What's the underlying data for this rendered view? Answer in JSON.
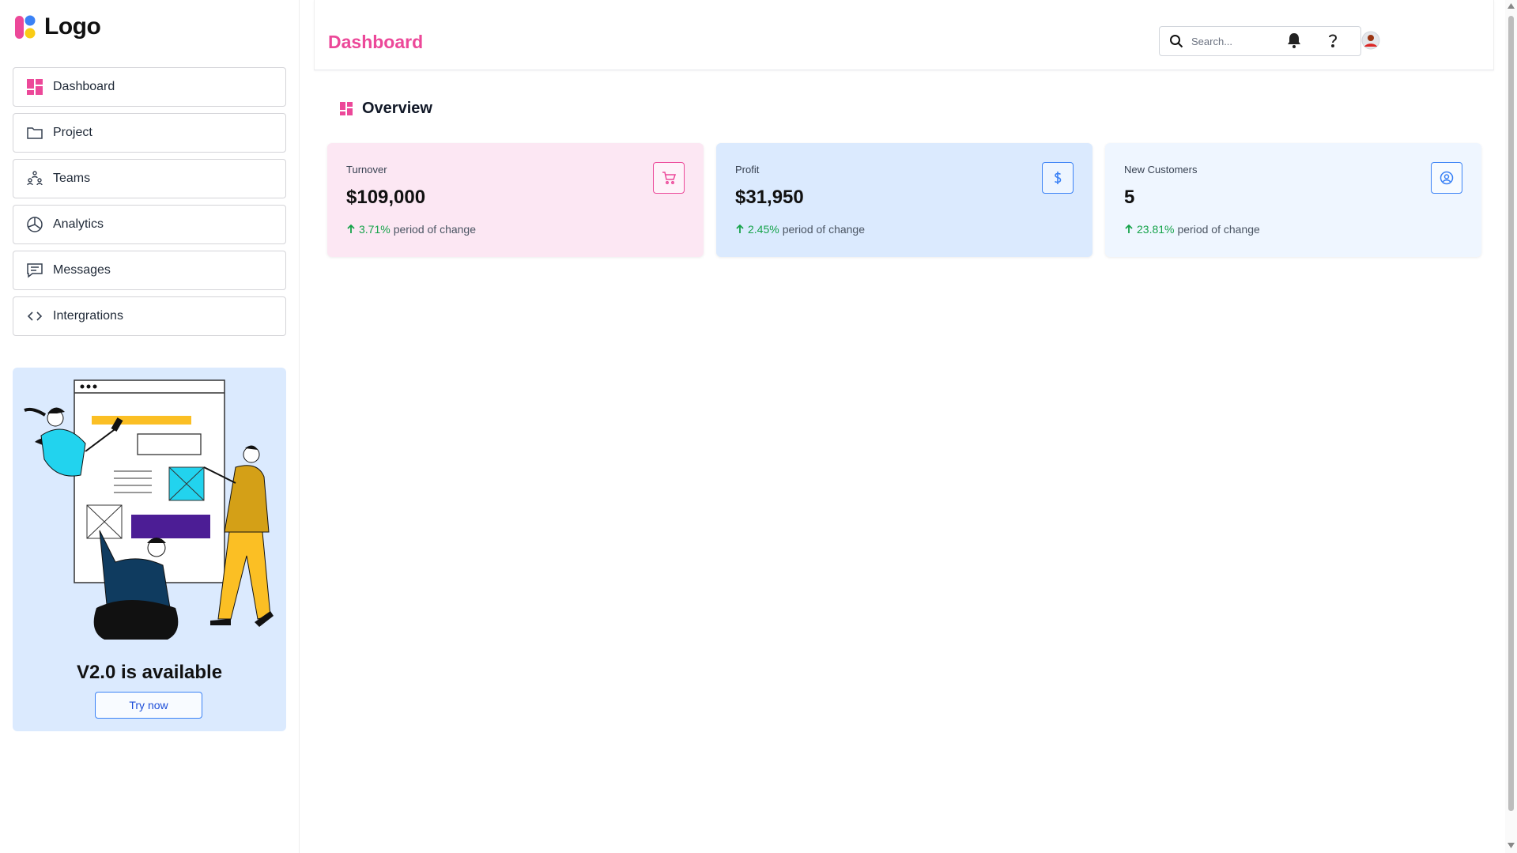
{
  "brand": {
    "logo_text": "Logo"
  },
  "nav": {
    "items": [
      {
        "label": "Dashboard",
        "icon": "dashboard-icon"
      },
      {
        "label": "Project",
        "icon": "folder-icon"
      },
      {
        "label": "Teams",
        "icon": "teams-icon"
      },
      {
        "label": "Analytics",
        "icon": "pie-chart-icon"
      },
      {
        "label": "Messages",
        "icon": "message-icon"
      },
      {
        "label": "Intergrations",
        "icon": "code-icon"
      }
    ]
  },
  "promo": {
    "title": "V2.0 is available",
    "button_label": "Try now"
  },
  "header": {
    "title": "Dashboard",
    "search_placeholder": "Search..."
  },
  "overview": {
    "title": "Overview",
    "cards": [
      {
        "label": "Turnover",
        "value": "$109,000",
        "change_pct": "3.71%",
        "change_text": "period of change",
        "icon": "cart-icon",
        "bg": "#fce7f3",
        "accent": "#ec4899"
      },
      {
        "label": "Profit",
        "value": "$31,950",
        "change_pct": "2.45%",
        "change_text": "period of change",
        "icon": "dollar-icon",
        "bg": "#dbeafe",
        "accent": "#3b82f6"
      },
      {
        "label": "New Customers",
        "value": "5",
        "change_pct": "23.81%",
        "change_text": "period of change",
        "icon": "user-circle-icon",
        "bg": "#eff6ff",
        "accent": "#3b82f6"
      }
    ]
  },
  "colors": {
    "brand_pink": "#ec4899",
    "positive_green": "#16a34a"
  }
}
